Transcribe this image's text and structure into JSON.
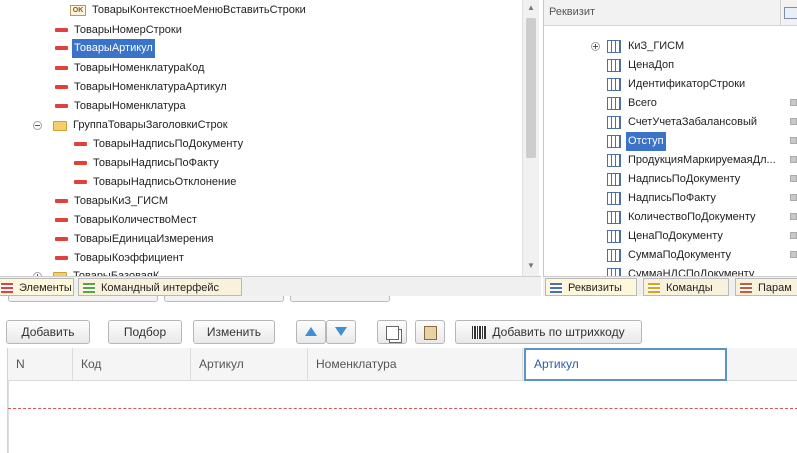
{
  "tree": {
    "items": [
      {
        "label": "ТоварыКонтекстноеМенюВставитьСтроки",
        "icon": "ok-command-icon"
      },
      {
        "label": "ТоварыНомерСтроки",
        "icon": "field-icon"
      },
      {
        "label": "ТоварыАртикул",
        "icon": "field-icon",
        "selected": true
      },
      {
        "label": "ТоварыНоменклатураКод",
        "icon": "field-icon"
      },
      {
        "label": "ТоварыНоменклатураАртикул",
        "icon": "field-icon"
      },
      {
        "label": "ТоварыНоменклатура",
        "icon": "field-icon"
      },
      {
        "label": "ГруппаТоварыЗаголовкиСтрок",
        "icon": "folder-icon"
      },
      {
        "label": "ТоварыНадписьПоДокументу",
        "icon": "field-icon"
      },
      {
        "label": "ТоварыНадписьПоФакту",
        "icon": "field-icon"
      },
      {
        "label": "ТоварыНадписьОтклонение",
        "icon": "field-icon"
      },
      {
        "label": "ТоварыКиЗ_ГИСМ",
        "icon": "field-icon"
      },
      {
        "label": "ТоварыКоличествоМест",
        "icon": "field-icon"
      },
      {
        "label": "ТоварыЕдиницаИзмерения",
        "icon": "field-icon"
      },
      {
        "label": "ТоварыКоэффициент",
        "icon": "field-icon"
      },
      {
        "label": "ТоварыБазоваяК",
        "icon": "folder-icon"
      }
    ]
  },
  "left_tabs": {
    "elements": "Элементы",
    "command_interface": "Командный интерфейс"
  },
  "props": {
    "header": "Реквизит",
    "items": [
      {
        "label": "КиЗ_ГИСМ"
      },
      {
        "label": "ЦенаДоп"
      },
      {
        "label": "ИдентификаторСтроки"
      },
      {
        "label": "Всего"
      },
      {
        "label": "СчетУчетаЗабалансовый"
      },
      {
        "label": "Отступ",
        "selected": true
      },
      {
        "label": "ПродукцияМаркируемаяДл..."
      },
      {
        "label": "НадписьПоДокументу"
      },
      {
        "label": "НадписьПоФакту"
      },
      {
        "label": "КоличествоПоДокументу"
      },
      {
        "label": "ЦенаПоДокументу"
      },
      {
        "label": "СуммаПоДокументу"
      },
      {
        "label": "СуммаНДСПоДокументу"
      }
    ]
  },
  "right_tabs": {
    "requisites": "Реквизиты",
    "commands": "Команды",
    "params": "Парам"
  },
  "toolbar": {
    "add": "Добавить",
    "pick": "Подбор",
    "edit": "Изменить",
    "add_barcode": "Добавить по штрихкоду"
  },
  "grid": {
    "columns": [
      "N",
      "Код",
      "Артикул",
      "Номенклатура",
      "Артикул"
    ]
  }
}
